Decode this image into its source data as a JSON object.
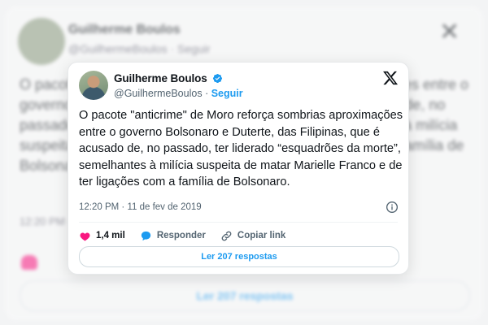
{
  "tweet": {
    "author_name": "Guilherme Boulos",
    "handle": "@GuilhermeBoulos",
    "separator": "·",
    "follow_label": "Seguir",
    "text": "O pacote \"anticrime\" de Moro reforça sombrias aproximações entre o governo Bolsonaro e Duterte, das Filipinas, que é acusado de, no passado, ter liderado “esquadrões da morte”, semelhantes à milícia suspeita de matar Marielle Franco e de ter ligações com a família de Bolsonaro.",
    "timestamp": "12:20 PM · 11 de fev de 2019",
    "likes": "1,4 mil",
    "reply_label": "Responder",
    "copy_link_label": "Copiar link",
    "read_replies_label": "Ler 207 respostas"
  },
  "background": {
    "name": "Guilherme Boulos",
    "handle": "@GuilhermeBoulos · Seguir",
    "text": "O pacote \"anticrime\" de Moro reforça sombrias aproximações entre o governo Bolsonaro e Duterte, das Filipinas, que é acusado de, no passado, ter liderado “esquadrões da morte”, semelhantes à milícia suspeita de matar Marielle Franco e de ter ligações com a família de Bolsonaro.",
    "time": "12:20 PM · 11 de fev de 2019",
    "replies": "Ler 207 respostas"
  },
  "colors": {
    "accent": "#1d9bf0",
    "like": "#f91880",
    "text": "#0f1419",
    "muted": "#536471"
  }
}
